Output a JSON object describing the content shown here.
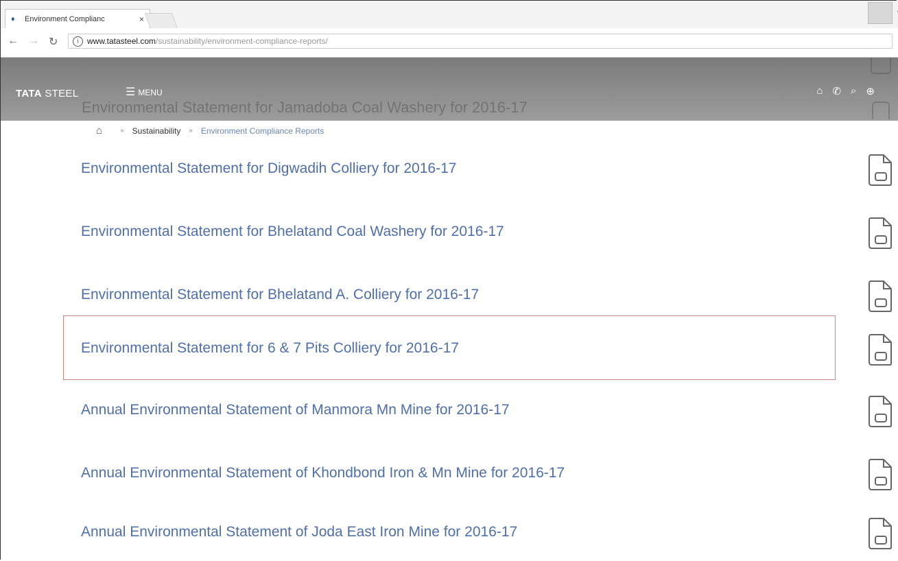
{
  "browser": {
    "tab_title": "Environment Complianc",
    "tab_close": "×",
    "url_host": "www.tatasteel.com",
    "url_path": "/sustainability/environment-compliance-reports/"
  },
  "header": {
    "logo_bold": "TATA",
    "logo_rest": " STEEL",
    "menu_label": "MENU",
    "ghost_text": "Environmental Statement for Jamadoba Coal Washery for 2016-17"
  },
  "breadcrumb": {
    "items": [
      "Sustainability",
      "Environment Compliance Reports"
    ],
    "separator": "»"
  },
  "reports": [
    {
      "title": "Environmental Statement for Digwadih Colliery for 2016-17"
    },
    {
      "title": "Environmental Statement for Bhelatand Coal Washery for 2016-17"
    },
    {
      "title": "Environmental Statement for Bhelatand A. Colliery for 2016-17"
    },
    {
      "title": "Environmental Statement for 6 & 7 Pits Colliery for 2016-17"
    },
    {
      "title": "Annual Environmental Statement of Manmora Mn Mine for 2016-17"
    },
    {
      "title": "Annual Environmental Statement of Khondbond Iron & Mn Mine for 2016-17"
    },
    {
      "title": "Annual Environmental Statement of Joda East Iron Mine for 2016-17"
    }
  ],
  "colors": {
    "link": "#4f6fac",
    "header_bg": "#8a8a8a",
    "highlight_border": "#c98484"
  }
}
